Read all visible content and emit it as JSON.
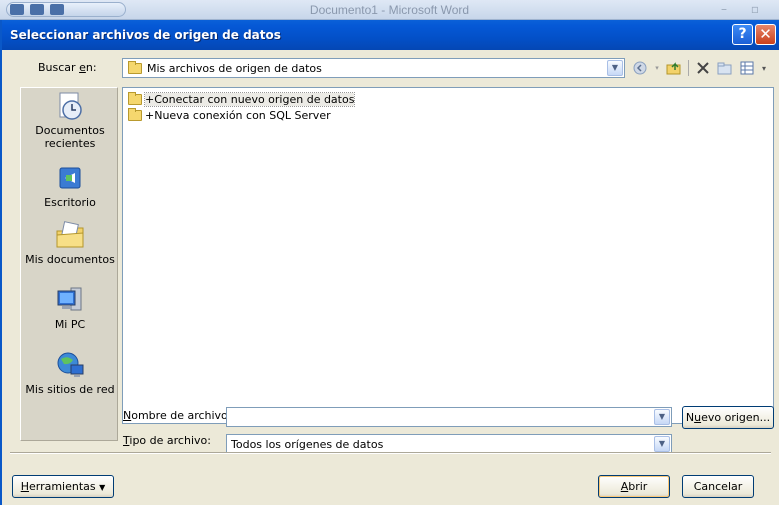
{
  "background_window": {
    "title": "Documento1 - Microsoft Word"
  },
  "dialog": {
    "title": "Seleccionar archivos de origen de datos",
    "help_label": "?",
    "close_label": "✕"
  },
  "look_in": {
    "label_prefix": "Buscar ",
    "label_accel": "e",
    "label_suffix": "n:",
    "value": "Mis archivos de origen de datos"
  },
  "toolbar": {
    "icons": [
      "back-icon",
      "up-folder-icon",
      "delete-icon",
      "new-folder-icon",
      "views-icon"
    ]
  },
  "places": [
    {
      "name": "Documentos recientes",
      "icon": "recent-documents-icon"
    },
    {
      "name": "Escritorio",
      "icon": "desktop-icon"
    },
    {
      "name": "Mis documentos",
      "icon": "my-documents-icon"
    },
    {
      "name": "Mi PC",
      "icon": "my-computer-icon"
    },
    {
      "name": "Mis sitios de red",
      "icon": "network-places-icon"
    }
  ],
  "files": [
    {
      "name": "+Conectar con nuevo origen de datos",
      "selected": true
    },
    {
      "name": "+Nueva conexión con SQL Server",
      "selected": false
    }
  ],
  "filename": {
    "label_accel": "N",
    "label_rest": "ombre de archivo:",
    "value": ""
  },
  "filetype": {
    "label_accel": "T",
    "label_rest": "ipo de archivo:",
    "value": "Todos los orígenes de datos"
  },
  "buttons": {
    "new_source_pre": "N",
    "new_source_accel": "u",
    "new_source_rest": "evo origen...",
    "open_accel": "A",
    "open_rest": "brir",
    "cancel": "Cancelar",
    "tools_accel": "H",
    "tools_rest": "erramientas"
  }
}
